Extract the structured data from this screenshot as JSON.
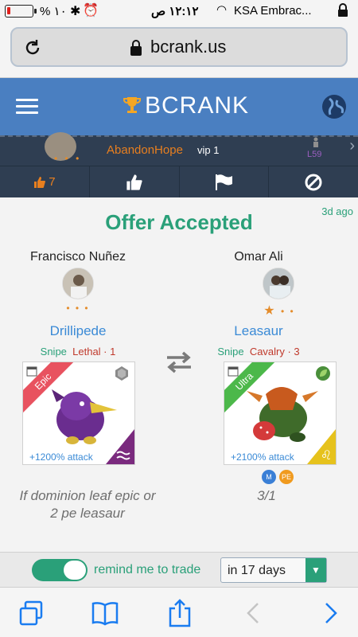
{
  "status_bar": {
    "battery": "% ١٠",
    "time": "١٢:١٢ ص",
    "carrier": "KSA Embrac...",
    "battery_level": 0.1
  },
  "browser": {
    "url": "bcrank.us"
  },
  "app": {
    "brand": "BCRANK"
  },
  "user": {
    "name": "AbandonHope",
    "vip": "vip 1",
    "level": "L59",
    "avatar_dots": "• • •"
  },
  "actions": {
    "like_count": "7"
  },
  "offer": {
    "status": "Offer Accepted",
    "time_ago": "3d ago",
    "left": {
      "player": "Francisco Nuñez",
      "stars": "• • •",
      "monster": "Drillipede",
      "tag1": "Snipe",
      "tag2": "Lethal · 1",
      "rarity": "Epic",
      "attack": "+1200% attack",
      "note": "If dominion leaf epic or 2 pe leasaur"
    },
    "right": {
      "player": "Omar Ali",
      "star_filled": "★",
      "stars": "• •",
      "monster": "Leasaur",
      "tag1": "Snipe",
      "tag2": "Cavalry · 3",
      "rarity": "Ultra",
      "attack": "+2100% attack",
      "badges": [
        "M",
        "PE"
      ],
      "note": "3/1"
    }
  },
  "reminder": {
    "label": "remind me to trade",
    "selected": "in 17 days",
    "enabled": true
  },
  "colors": {
    "accent_green": "#2aa079",
    "header_blue": "#4a7fc1",
    "dark_strip": "#2f3e52",
    "orange": "#e87f1f",
    "link_blue": "#3a8ad6"
  }
}
